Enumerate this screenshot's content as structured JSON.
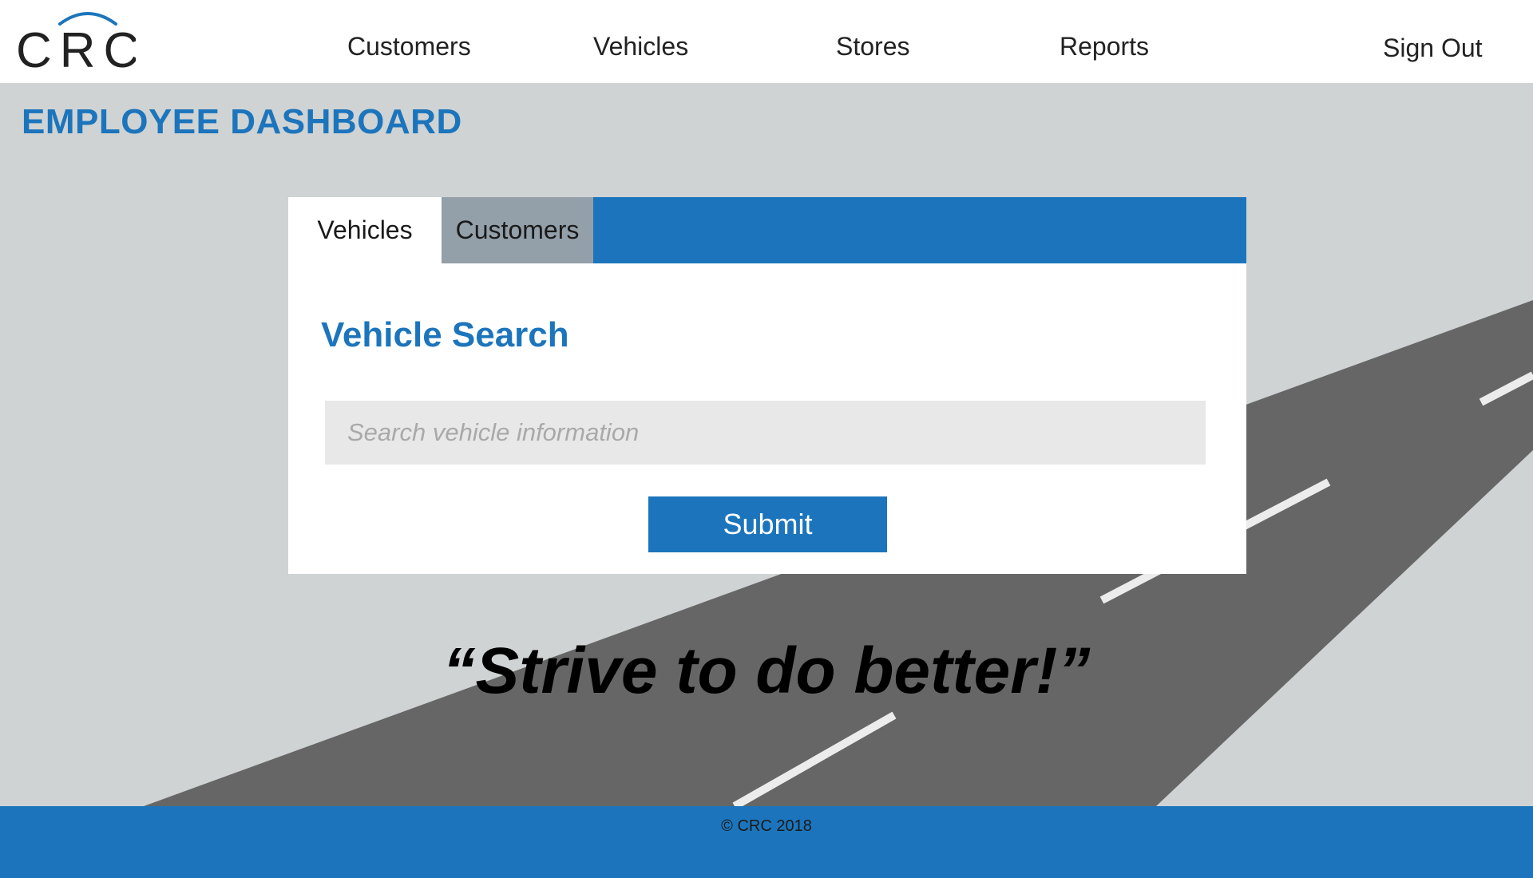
{
  "header": {
    "logo_text": "CRC",
    "nav": [
      {
        "label": "Customers"
      },
      {
        "label": "Vehicles"
      },
      {
        "label": "Stores"
      },
      {
        "label": "Reports"
      }
    ],
    "sign_out_label": "Sign Out"
  },
  "main": {
    "page_title": "EMPLOYEE DASHBOARD",
    "tabs": [
      {
        "label": "Vehicles",
        "active": true
      },
      {
        "label": "Customers",
        "active": false
      }
    ],
    "search_title": "Vehicle Search",
    "search": {
      "value": "",
      "placeholder": "Search vehicle information"
    },
    "submit_label": "Submit",
    "quote": "“Strive to do better!”"
  },
  "footer": {
    "copyright": "© CRC 2018"
  },
  "colors": {
    "accent": "#1c75bc",
    "background": "#cfd3d4",
    "road": "#666666",
    "inactive_tab": "#939fa9",
    "input_bg": "#e8e8e8"
  }
}
